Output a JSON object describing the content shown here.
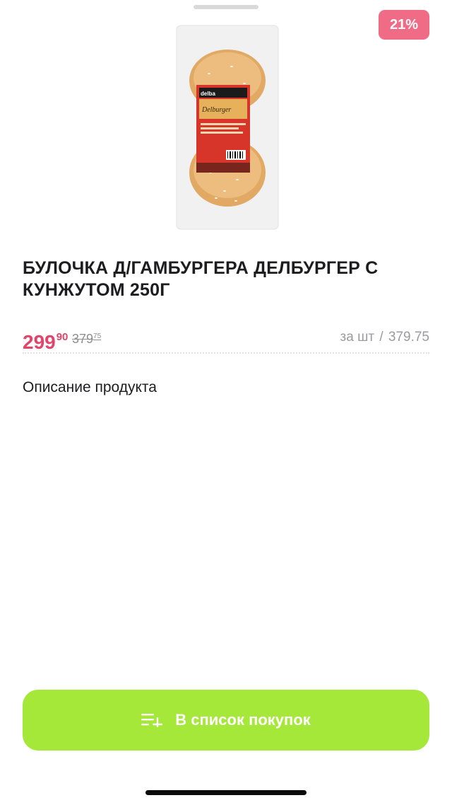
{
  "badge": {
    "discount": "21%"
  },
  "product": {
    "title": "БУЛОЧКА Д/ГАМБУРГЕРА ДЕЛБУРГЕР С КУНЖУТОМ 250Г",
    "package_brand": "delba",
    "package_name": "Delburger"
  },
  "price": {
    "current_main": "299",
    "current_cents": "90",
    "old_main": "379",
    "old_cents": "75",
    "unit_label": "за шт",
    "unit_separator": "/",
    "unit_value": "379.75"
  },
  "description": {
    "heading": "Описание продукта"
  },
  "actions": {
    "add_to_list_label": "В список покупок",
    "add_to_list_icon": "list-add-icon"
  },
  "colors": {
    "badge": "#f06b85",
    "price": "#e2446a",
    "button": "#a5e83a"
  }
}
